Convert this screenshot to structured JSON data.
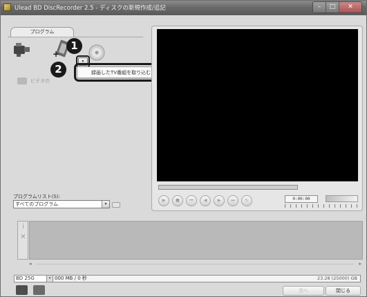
{
  "window": {
    "title": "Ulead BD DiscRecorder 2.5 - ディスクの新規作成/追記",
    "minimize_label": "–",
    "maximize_label": "□",
    "close_label": "✕"
  },
  "left": {
    "tab_label": "プログラム",
    "video_button_label": "ビデオの",
    "dropdown_arrow": "▾",
    "menu_item_label": "録画したTV番組を取り込む..."
  },
  "steps": {
    "one": "1",
    "two": "2"
  },
  "program_list": {
    "label": "プログラムリスト(S):",
    "selected": "すべてのプログラム",
    "arrow": "▾"
  },
  "player": {
    "timecode": "0:00:00",
    "buttons": [
      {
        "icon": "play-icon",
        "glyph": "▶"
      },
      {
        "icon": "stop-icon",
        "glyph": "■"
      },
      {
        "icon": "start-icon",
        "glyph": "⏮"
      },
      {
        "icon": "prev-frame-icon",
        "glyph": "◀"
      },
      {
        "icon": "next-frame-icon",
        "glyph": "▶"
      },
      {
        "icon": "end-icon",
        "glyph": "⏭"
      },
      {
        "icon": "repeat-icon",
        "glyph": "↻"
      }
    ]
  },
  "timeline": {
    "info_glyph": "i",
    "remove_glyph": "✕",
    "scroll_left": "◂",
    "scroll_right": "▸"
  },
  "status": {
    "disc_type": "BD 25G",
    "disc_arrow": "▾",
    "usage": "000 MB / 0 秒",
    "capacity": "23.28 (25000) GB"
  },
  "footer": {
    "next_label": "次へ",
    "close_label": "閉じる"
  }
}
